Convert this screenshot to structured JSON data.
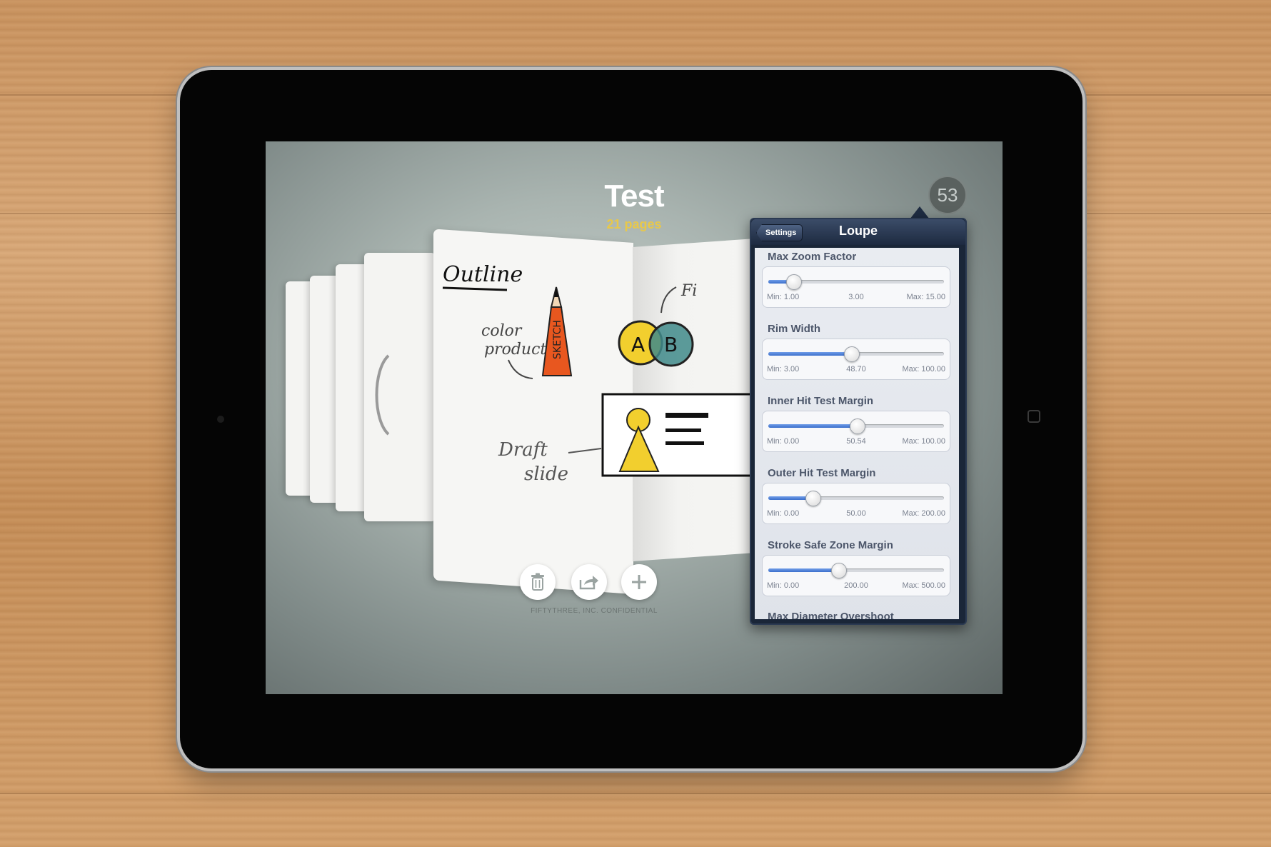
{
  "screen": {
    "notebook_title": "Test",
    "page_count": "21 pages",
    "logo_text": "53",
    "footer_note": "FIFTYTHREE, INC. CONFIDENTIAL"
  },
  "sketch": {
    "outline_text": "Outline",
    "color_text": "color",
    "product_text": "product",
    "pencil_text": "SKETCH",
    "draft_text": "Draft",
    "slide_text": "slide",
    "circle_a": "A",
    "circle_b": "B",
    "fi_text": "Fi"
  },
  "toolbar": {
    "delete_icon": "trash-icon",
    "share_icon": "share-icon",
    "add_icon": "plus-icon"
  },
  "popover": {
    "back_label": "Settings",
    "title": "Loupe",
    "settings": [
      {
        "label": "Max Zoom Factor",
        "min": "Min: 1.00",
        "current": "3.00",
        "max": "Max: 15.00",
        "fraction": 0.143
      },
      {
        "label": "Rim Width",
        "min": "Min: 3.00",
        "current": "48.70",
        "max": "Max: 100.00",
        "fraction": 0.471
      },
      {
        "label": "Inner Hit Test Margin",
        "min": "Min: 0.00",
        "current": "50.54",
        "max": "Max: 100.00",
        "fraction": 0.505
      },
      {
        "label": "Outer Hit Test Margin",
        "min": "Min: 0.00",
        "current": "50.00",
        "max": "Max: 200.00",
        "fraction": 0.25
      },
      {
        "label": "Stroke Safe Zone Margin",
        "min": "Min: 0.00",
        "current": "200.00",
        "max": "Max: 500.00",
        "fraction": 0.4
      },
      {
        "label": "Max Diameter Overshoot"
      }
    ]
  },
  "colors": {
    "accent_yellow": "#e8c84a",
    "slider_fill": "#3b6fcc",
    "popover_navy": "#1a2638"
  }
}
